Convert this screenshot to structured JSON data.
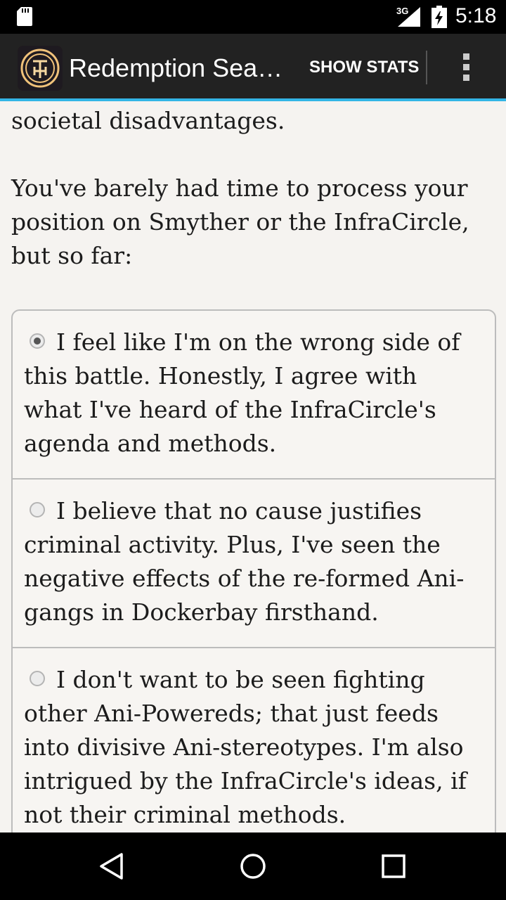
{
  "status_bar": {
    "network": "3G",
    "time": "5:18",
    "icons": [
      "sd-card-icon",
      "signal-icon",
      "battery-charging-icon"
    ]
  },
  "app_bar": {
    "title": "Redemption Seas...",
    "action_label": "SHOW STATS",
    "icons": [
      "app-logo-icon",
      "overflow-menu-icon"
    ],
    "accent_color": "#33b5e5"
  },
  "content": {
    "partial_line": "societal disadvantages.",
    "prompt": "You've barely had time to process your position on Smyther or the InfraCircle, but so far:",
    "choices": [
      {
        "label": "I feel like I'm on the wrong side of this battle. Honestly, I agree with what I've heard of the InfraCircle's agenda and methods.",
        "selected": true
      },
      {
        "label": "I believe that no cause justifies criminal activity. Plus, I've seen the negative effects of the re-formed Ani-gangs in Dockerbay firsthand.",
        "selected": false
      },
      {
        "label": "I don't want to be seen fighting other Ani-Powereds; that just feeds into divisive Ani-stereotypes. I'm also intrigued by the InfraCircle's ideas, if not their criminal methods.",
        "selected": false
      }
    ]
  },
  "nav_bar": {
    "icons": [
      "back-icon",
      "home-icon",
      "recents-icon"
    ]
  }
}
